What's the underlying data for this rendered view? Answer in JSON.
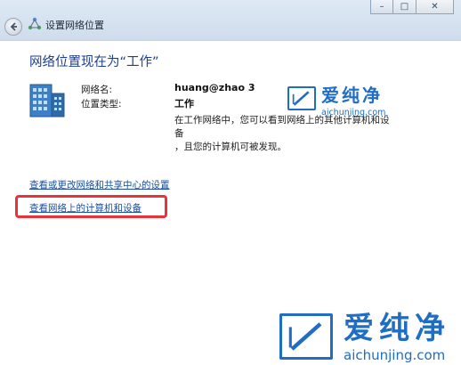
{
  "window": {
    "title": "设置网络位置",
    "controls": {
      "minimize": "–",
      "maximize": "□",
      "close": "✕"
    },
    "icons": {
      "back": "back-arrow-icon",
      "network": "network-icon"
    }
  },
  "main": {
    "heading": "网络位置现在为“工作”",
    "network_name_label": "网络名:",
    "network_name_value": "huang@zhao  3",
    "location_type_label": "位置类型:",
    "location_type_value": "工作",
    "description_line1": "在工作网络中，您可以看到网络上的其他计算机和设备",
    "description_line2": "，且您的计算机可被发现。",
    "link_network_center": "查看或更改网络和共享中心的设置",
    "link_view_devices": "查看网络上的计算机和设备"
  },
  "watermark": {
    "cn": "爱纯净",
    "url": "aichunjing.com",
    "color": "#1f6ec4"
  },
  "colors": {
    "heading": "#1e3f8c",
    "link": "#1a4fa3",
    "highlight": "#e8323c"
  }
}
